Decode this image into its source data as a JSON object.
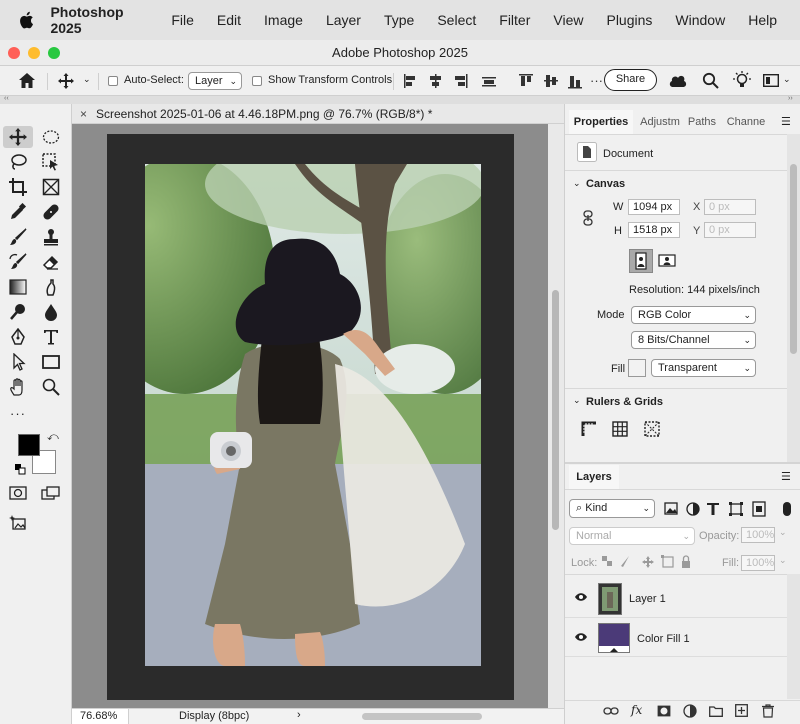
{
  "menubar": {
    "app_name": "Photoshop 2025",
    "items": [
      "File",
      "Edit",
      "Image",
      "Layer",
      "Type",
      "Select",
      "Filter",
      "View",
      "Plugins",
      "Window",
      "Help"
    ]
  },
  "window": {
    "title": "Adobe Photoshop 2025"
  },
  "options": {
    "auto_select_label": "Auto-Select:",
    "auto_select_value": "Layer",
    "transform_label": "Show Transform Controls",
    "share_label": "Share"
  },
  "document": {
    "tab_title": "Screenshot 2025-01-06 at 4.46.18PM.png @ 76.7% (RGB/8*) *",
    "zoom": "76.68%",
    "display_info": "Display (8bpc)"
  },
  "properties": {
    "tabs": [
      "Properties",
      "Adjustm",
      "Paths",
      "Channe"
    ],
    "section_label": "Document",
    "canvas_header": "Canvas",
    "w_label": "W",
    "w_value": "1094 px",
    "h_label": "H",
    "h_value": "1518 px",
    "x_label": "X",
    "x_placeholder": "0 px",
    "y_label": "Y",
    "y_placeholder": "0 px",
    "resolution": "Resolution: 144 pixels/inch",
    "mode_label": "Mode",
    "mode_value": "RGB Color",
    "depth_value": "8 Bits/Channel",
    "fill_label": "Fill",
    "fill_value": "Transparent",
    "rulers_header": "Rulers & Grids"
  },
  "layers": {
    "tab": "Layers",
    "filter_kind": "Kind",
    "blend_mode": "Normal",
    "opacity_label": "Opacity:",
    "opacity_value": "100%",
    "lock_label": "Lock:",
    "fill_label": "Fill:",
    "fill_value": "100%",
    "items": [
      {
        "name": "Layer 1"
      },
      {
        "name": "Color Fill 1",
        "color": "#4b3a78"
      }
    ]
  },
  "colors": {
    "foreground": "#000000",
    "background": "#ffffff",
    "color_fill": "#4b3a78"
  }
}
